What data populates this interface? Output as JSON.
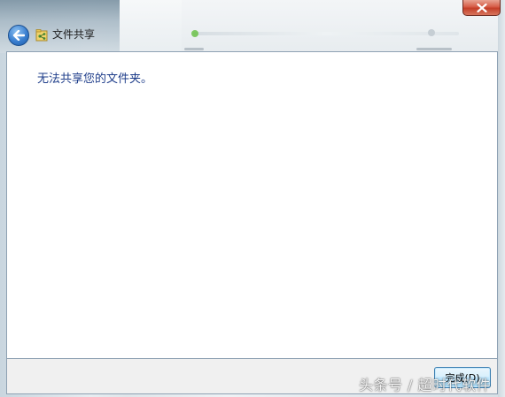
{
  "window": {
    "title": "文件共享",
    "close_label": "×"
  },
  "main": {
    "message": "无法共享您的文件夹。"
  },
  "footer": {
    "ok_button": "完成(D)"
  },
  "overlay": {
    "watermark": "头条号 / 超时代软件"
  },
  "colors": {
    "message_text": "#1e3d8a",
    "close_button": "#c23b25",
    "back_button": "#3a7fd0"
  },
  "icons": {
    "back": "back-arrow-icon",
    "title": "file-sharing-icon",
    "close": "close-icon"
  }
}
